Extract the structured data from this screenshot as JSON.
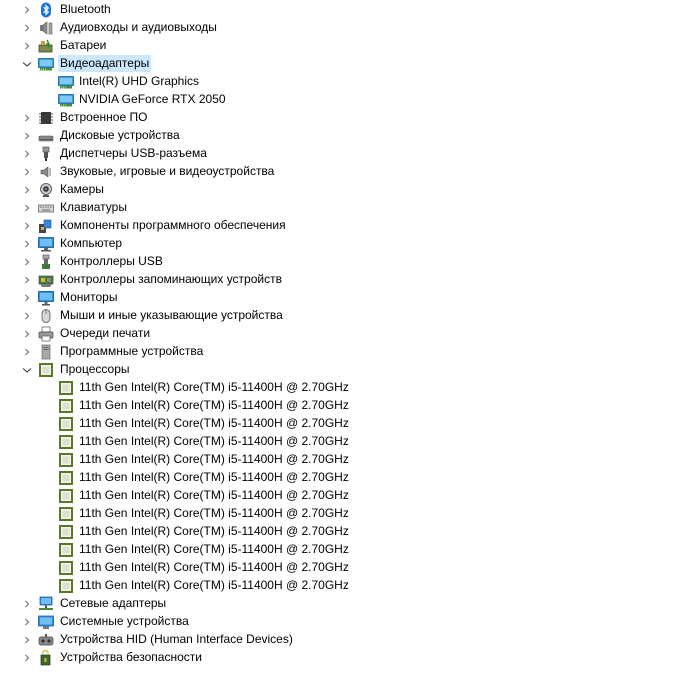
{
  "tree": [
    {
      "label": "Bluetooth",
      "icon": "bluetooth-icon",
      "level": 0,
      "state": "collapsed"
    },
    {
      "label": "Аудиовходы и аудиовыходы",
      "icon": "speaker-icon",
      "level": 0,
      "state": "collapsed"
    },
    {
      "label": "Батареи",
      "icon": "battery-icon",
      "level": 0,
      "state": "collapsed"
    },
    {
      "label": "Видеоадаптеры",
      "icon": "display-adapter-icon",
      "level": 0,
      "state": "expanded",
      "selected": true
    },
    {
      "label": "Intel(R) UHD Graphics",
      "icon": "display-adapter-icon",
      "level": 1
    },
    {
      "label": "NVIDIA GeForce RTX 2050",
      "icon": "display-adapter-icon",
      "level": 1
    },
    {
      "label": "Встроенное ПО",
      "icon": "firmware-chip-icon",
      "level": 0,
      "state": "collapsed"
    },
    {
      "label": "Дисковые устройства",
      "icon": "disk-drive-icon",
      "level": 0,
      "state": "collapsed"
    },
    {
      "label": "Диспетчеры USB-разъема",
      "icon": "usb-connector-icon",
      "level": 0,
      "state": "collapsed"
    },
    {
      "label": "Звуковые, игровые и видеоустройства",
      "icon": "sound-icon",
      "level": 0,
      "state": "collapsed"
    },
    {
      "label": "Камеры",
      "icon": "camera-icon",
      "level": 0,
      "state": "collapsed"
    },
    {
      "label": "Клавиатуры",
      "icon": "keyboard-icon",
      "level": 0,
      "state": "collapsed"
    },
    {
      "label": "Компоненты программного обеспечения",
      "icon": "software-component-icon",
      "level": 0,
      "state": "collapsed"
    },
    {
      "label": "Компьютер",
      "icon": "computer-icon",
      "level": 0,
      "state": "collapsed"
    },
    {
      "label": "Контроллеры USB",
      "icon": "usb-controller-icon",
      "level": 0,
      "state": "collapsed"
    },
    {
      "label": "Контроллеры запоминающих устройств",
      "icon": "storage-controller-icon",
      "level": 0,
      "state": "collapsed"
    },
    {
      "label": "Мониторы",
      "icon": "monitor-icon",
      "level": 0,
      "state": "collapsed"
    },
    {
      "label": "Мыши и иные указывающие устройства",
      "icon": "mouse-icon",
      "level": 0,
      "state": "collapsed"
    },
    {
      "label": "Очереди печати",
      "icon": "printer-icon",
      "level": 0,
      "state": "collapsed"
    },
    {
      "label": "Программные устройства",
      "icon": "software-device-icon",
      "level": 0,
      "state": "collapsed"
    },
    {
      "label": "Процессоры",
      "icon": "processor-icon",
      "level": 0,
      "state": "expanded"
    },
    {
      "label": "11th Gen Intel(R) Core(TM) i5-11400H @ 2.70GHz",
      "icon": "processor-icon",
      "level": 1
    },
    {
      "label": "11th Gen Intel(R) Core(TM) i5-11400H @ 2.70GHz",
      "icon": "processor-icon",
      "level": 1
    },
    {
      "label": "11th Gen Intel(R) Core(TM) i5-11400H @ 2.70GHz",
      "icon": "processor-icon",
      "level": 1
    },
    {
      "label": "11th Gen Intel(R) Core(TM) i5-11400H @ 2.70GHz",
      "icon": "processor-icon",
      "level": 1
    },
    {
      "label": "11th Gen Intel(R) Core(TM) i5-11400H @ 2.70GHz",
      "icon": "processor-icon",
      "level": 1
    },
    {
      "label": "11th Gen Intel(R) Core(TM) i5-11400H @ 2.70GHz",
      "icon": "processor-icon",
      "level": 1
    },
    {
      "label": "11th Gen Intel(R) Core(TM) i5-11400H @ 2.70GHz",
      "icon": "processor-icon",
      "level": 1
    },
    {
      "label": "11th Gen Intel(R) Core(TM) i5-11400H @ 2.70GHz",
      "icon": "processor-icon",
      "level": 1
    },
    {
      "label": "11th Gen Intel(R) Core(TM) i5-11400H @ 2.70GHz",
      "icon": "processor-icon",
      "level": 1
    },
    {
      "label": "11th Gen Intel(R) Core(TM) i5-11400H @ 2.70GHz",
      "icon": "processor-icon",
      "level": 1
    },
    {
      "label": "11th Gen Intel(R) Core(TM) i5-11400H @ 2.70GHz",
      "icon": "processor-icon",
      "level": 1
    },
    {
      "label": "11th Gen Intel(R) Core(TM) i5-11400H @ 2.70GHz",
      "icon": "processor-icon",
      "level": 1
    },
    {
      "label": "Сетевые адаптеры",
      "icon": "network-adapter-icon",
      "level": 0,
      "state": "collapsed"
    },
    {
      "label": "Системные устройства",
      "icon": "system-device-icon",
      "level": 0,
      "state": "collapsed"
    },
    {
      "label": "Устройства HID (Human Interface Devices)",
      "icon": "hid-icon",
      "level": 0,
      "state": "collapsed"
    },
    {
      "label": "Устройства безопасности",
      "icon": "security-device-icon",
      "level": 0,
      "state": "collapsed"
    }
  ],
  "colors": {
    "selection": "#cce8ff",
    "chevron": "#6d6d6d",
    "cpu_green": "#5a7a2a",
    "monitor_blue": "#2a8fd8"
  }
}
